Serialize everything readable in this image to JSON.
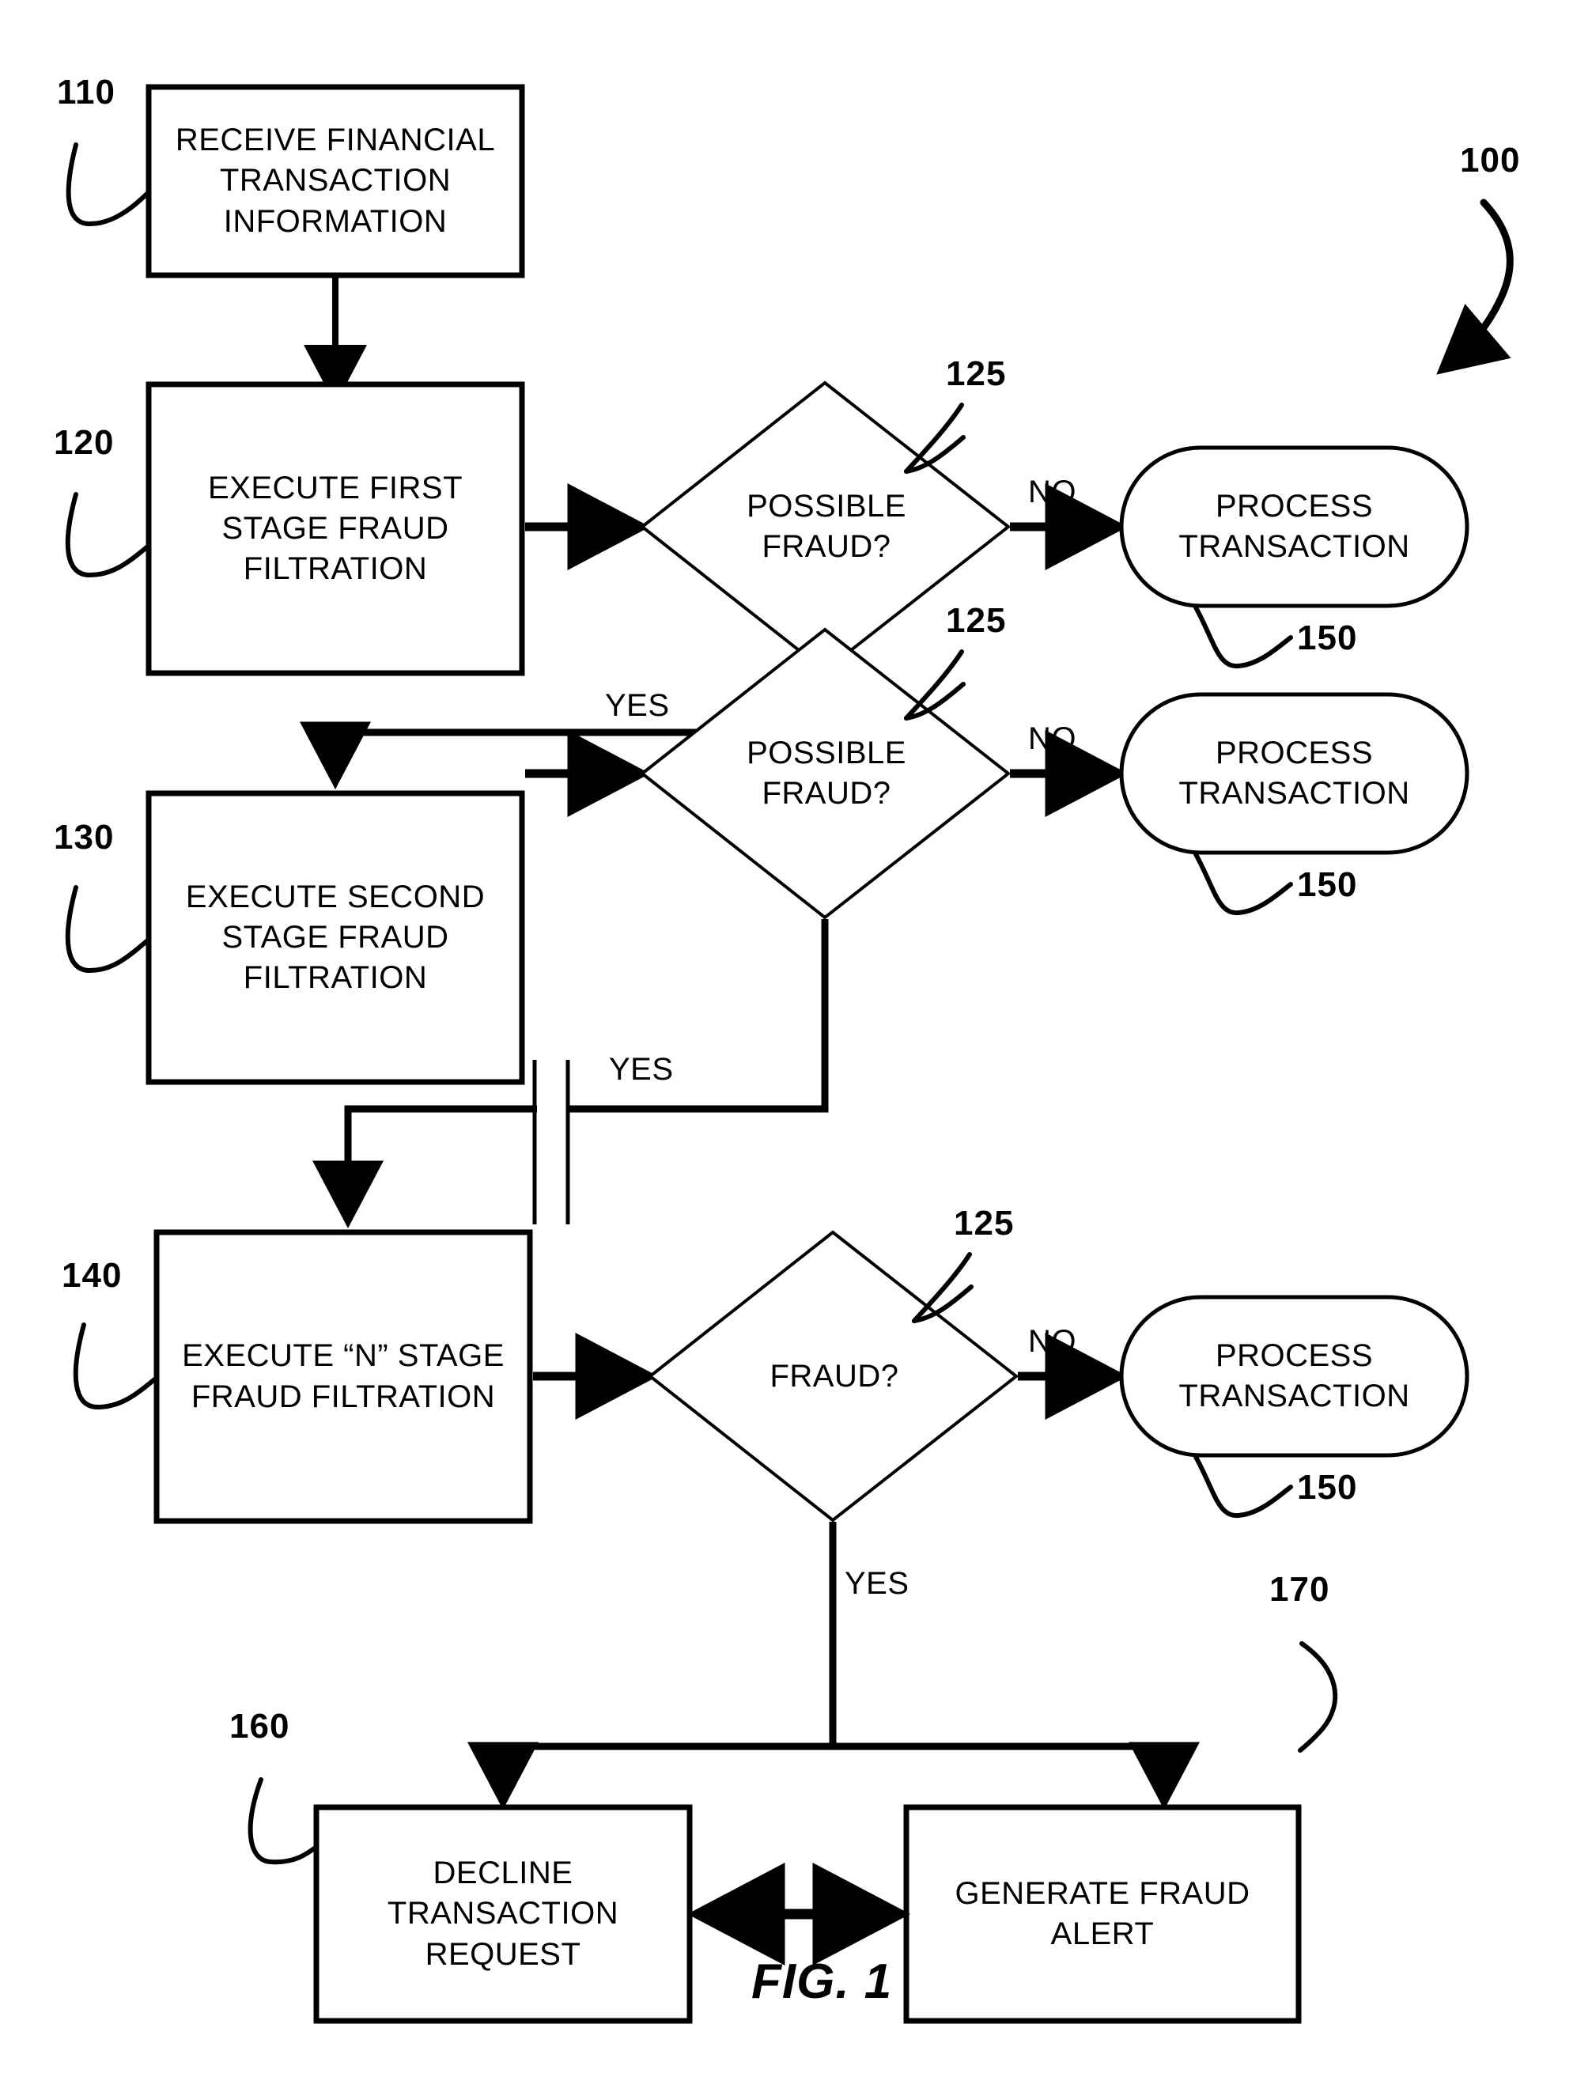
{
  "figure": {
    "caption": "FIG. 1",
    "system_ref": "100"
  },
  "nodes": [
    {
      "id": "receive",
      "shape": "rect",
      "ref": "110",
      "lines": [
        "RECEIVE FINANCIAL",
        "TRANSACTION",
        "INFORMATION"
      ]
    },
    {
      "id": "stage1",
      "shape": "rect",
      "ref": "120",
      "lines": [
        "EXECUTE FIRST",
        "STAGE FRAUD",
        "FILTRATION"
      ]
    },
    {
      "id": "decision1",
      "shape": "diamond",
      "ref": "125",
      "lines": [
        "POSSIBLE",
        "FRAUD?"
      ]
    },
    {
      "id": "process1",
      "shape": "stadium",
      "ref": "150",
      "lines": [
        "PROCESS",
        "TRANSACTION"
      ]
    },
    {
      "id": "stage2",
      "shape": "rect",
      "ref": "130",
      "lines": [
        "EXECUTE SECOND",
        "STAGE FRAUD",
        "FILTRATION"
      ]
    },
    {
      "id": "decision2",
      "shape": "diamond",
      "ref": "125",
      "lines": [
        "POSSIBLE",
        "FRAUD?"
      ]
    },
    {
      "id": "process2",
      "shape": "stadium",
      "ref": "150",
      "lines": [
        "PROCESS",
        "TRANSACTION"
      ]
    },
    {
      "id": "stageN",
      "shape": "rect",
      "ref": "140",
      "lines": [
        "EXECUTE “N” STAGE",
        "FRAUD FILTRATION"
      ]
    },
    {
      "id": "decisionN",
      "shape": "diamond",
      "ref": "125",
      "lines": [
        "FRAUD?"
      ]
    },
    {
      "id": "process3",
      "shape": "stadium",
      "ref": "150",
      "lines": [
        "PROCESS",
        "TRANSACTION"
      ]
    },
    {
      "id": "decline",
      "shape": "rect",
      "ref": "160",
      "lines": [
        "DECLINE",
        "TRANSACTION",
        "REQUEST"
      ]
    },
    {
      "id": "alert",
      "shape": "rect",
      "ref": "170",
      "lines": [
        "GENERATE FRAUD",
        "ALERT"
      ]
    }
  ],
  "edge_labels": {
    "no1": "NO",
    "yes1": "YES",
    "no2": "NO",
    "yes2": "YES",
    "no3": "NO",
    "yes3": "YES"
  },
  "colors": {
    "stroke": "#000000",
    "fill": "#ffffff",
    "text": "#000000"
  }
}
